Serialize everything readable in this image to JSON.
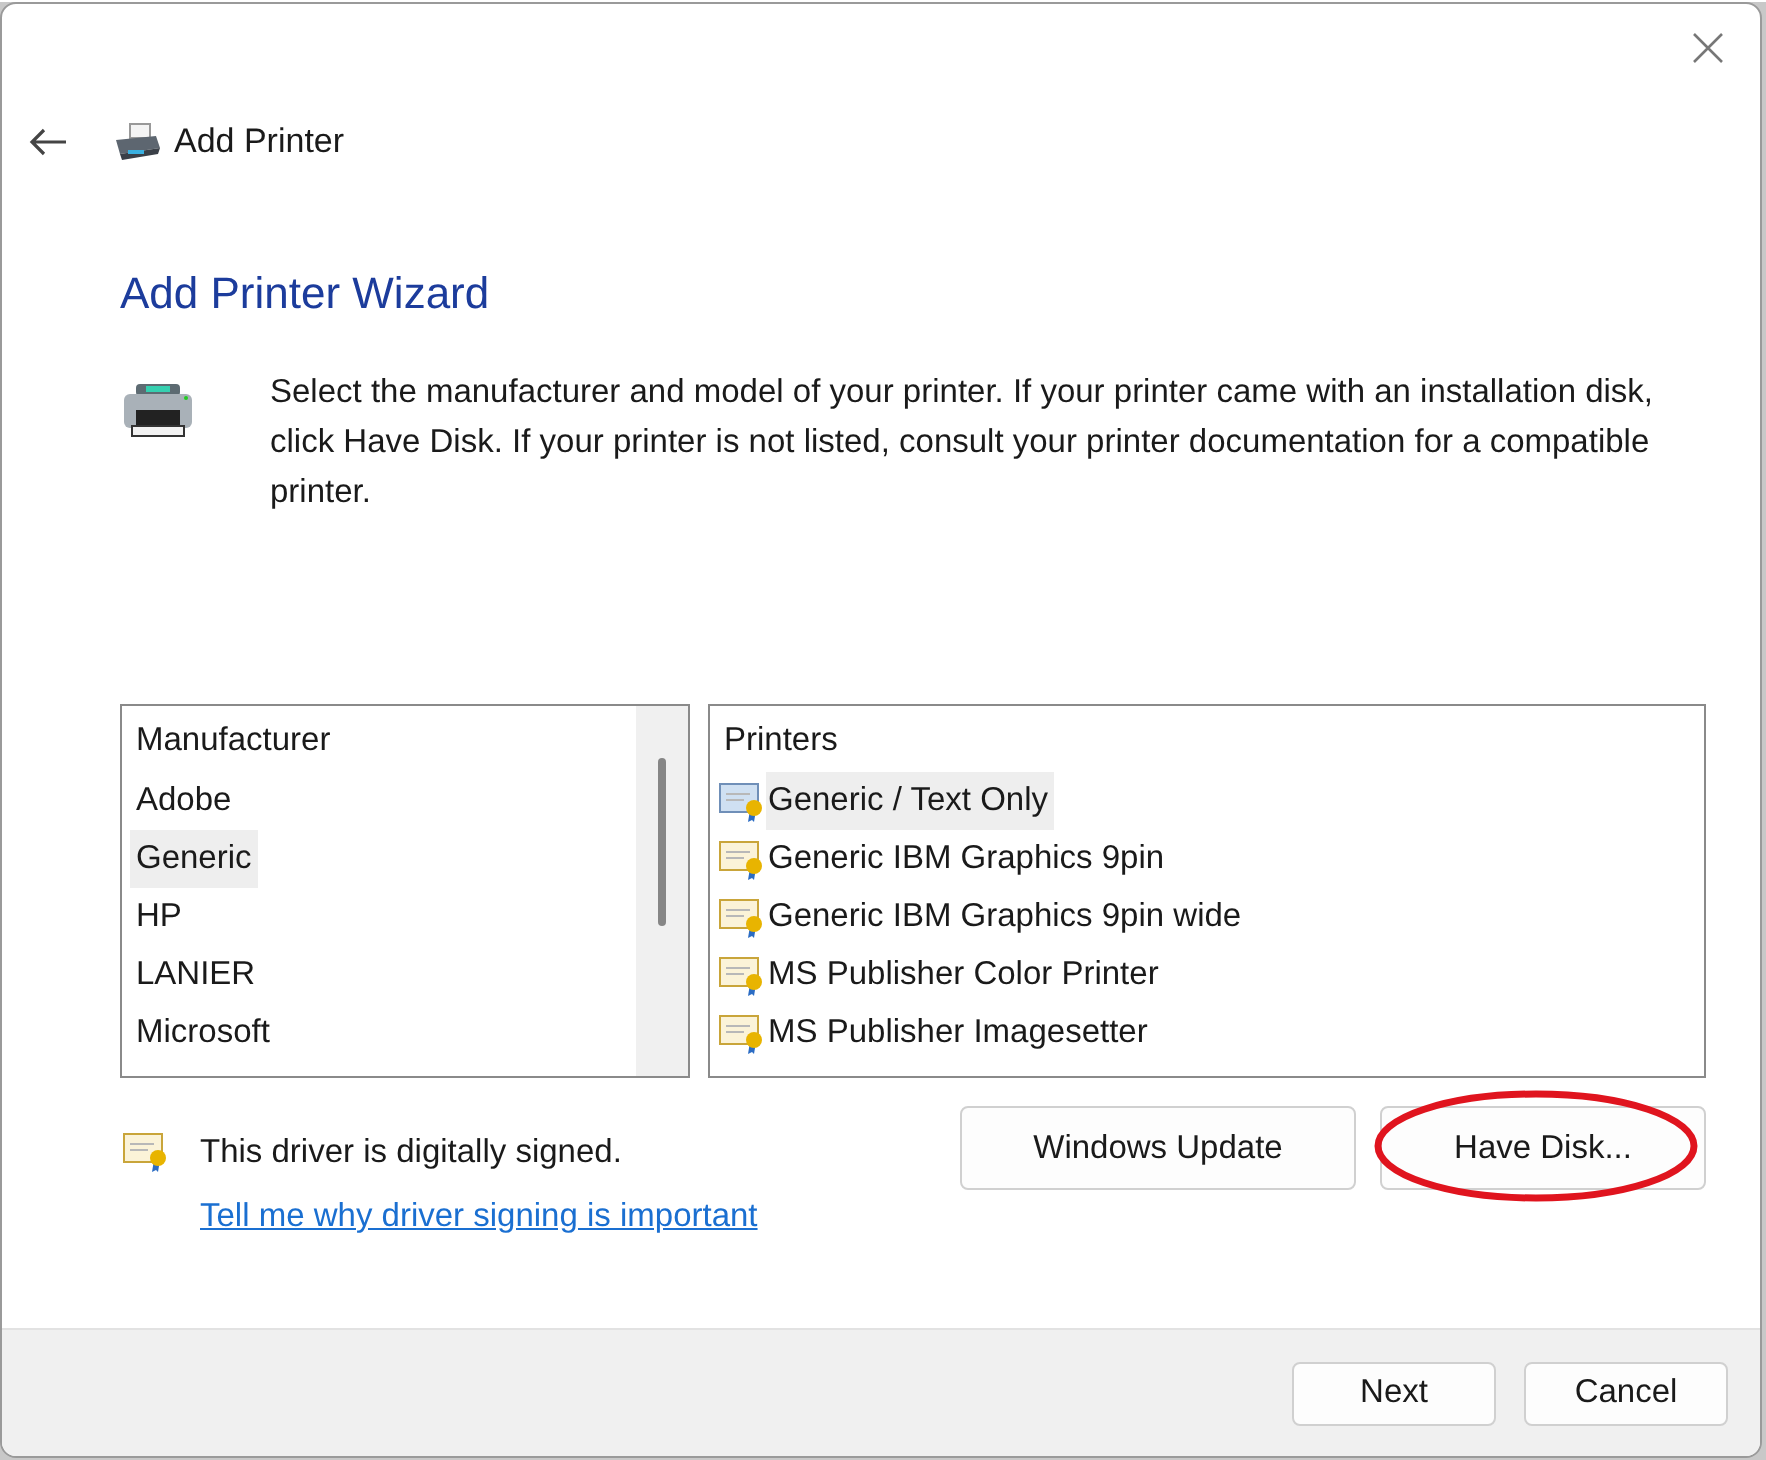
{
  "window": {
    "title": "Add Printer"
  },
  "heading": "Add Printer Wizard",
  "description": "Select the manufacturer and model of your printer. If your printer came with an installation disk, click Have Disk. If your printer is not listed, consult your printer documentation for a compatible printer.",
  "manufacturers": {
    "header": "Manufacturer",
    "items": [
      {
        "label": "Adobe",
        "selected": false
      },
      {
        "label": "Generic",
        "selected": true
      },
      {
        "label": "HP",
        "selected": false
      },
      {
        "label": "LANIER",
        "selected": false
      },
      {
        "label": "Microsoft",
        "selected": false
      }
    ]
  },
  "printers": {
    "header": "Printers",
    "items": [
      {
        "label": "Generic / Text Only",
        "selected": true
      },
      {
        "label": "Generic IBM Graphics 9pin",
        "selected": false
      },
      {
        "label": "Generic IBM Graphics 9pin wide",
        "selected": false
      },
      {
        "label": "MS Publisher Color Printer",
        "selected": false
      },
      {
        "label": "MS Publisher Imagesetter",
        "selected": false
      }
    ]
  },
  "signature": {
    "text": "This driver is digitally signed.",
    "link": "Tell me why driver signing is important"
  },
  "buttons": [
    {
      "label": "Windows Update",
      "circled": false
    },
    {
      "label": "Have Disk...",
      "circled": true
    }
  ],
  "footer_buttons": [
    "Next",
    "Cancel"
  ]
}
